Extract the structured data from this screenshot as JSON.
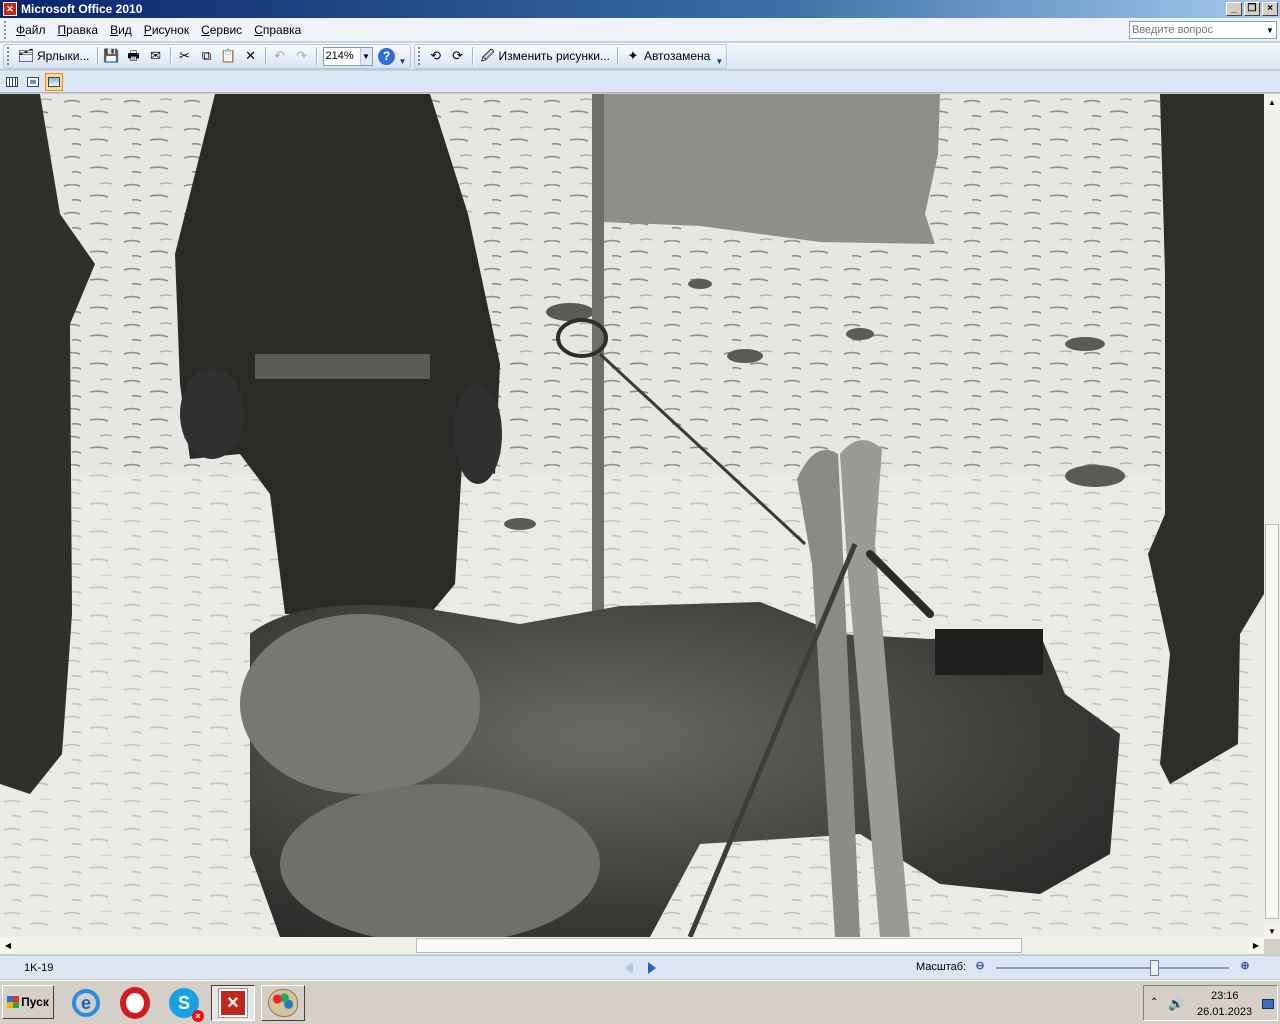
{
  "window": {
    "title": "Microsoft Office 2010",
    "controls": [
      "minimize-icon",
      "restore-icon",
      "close-icon"
    ]
  },
  "menu": {
    "items": [
      "Файл",
      "Правка",
      "Вид",
      "Рисунок",
      "Сервис",
      "Справка"
    ],
    "ask_placeholder": "Введите вопрос"
  },
  "toolbar": {
    "shortcuts_label": "Ярлыки...",
    "zoom_value": "214%",
    "edit_pictures_label": "Изменить рисунки...",
    "autocorrect_label": "Автозамена"
  },
  "status": {
    "file_label": "1K-19",
    "zoom_label": "Масштаб:",
    "zoom_fraction": 0.68
  },
  "taskbar": {
    "start_label": "Пуск",
    "time": "23:16",
    "date": "26.01.2023"
  },
  "colors": {
    "title_gradient_start": "#0a246a",
    "toolbar_bg": "#dce7f5",
    "active_view": "#ffd98c"
  }
}
